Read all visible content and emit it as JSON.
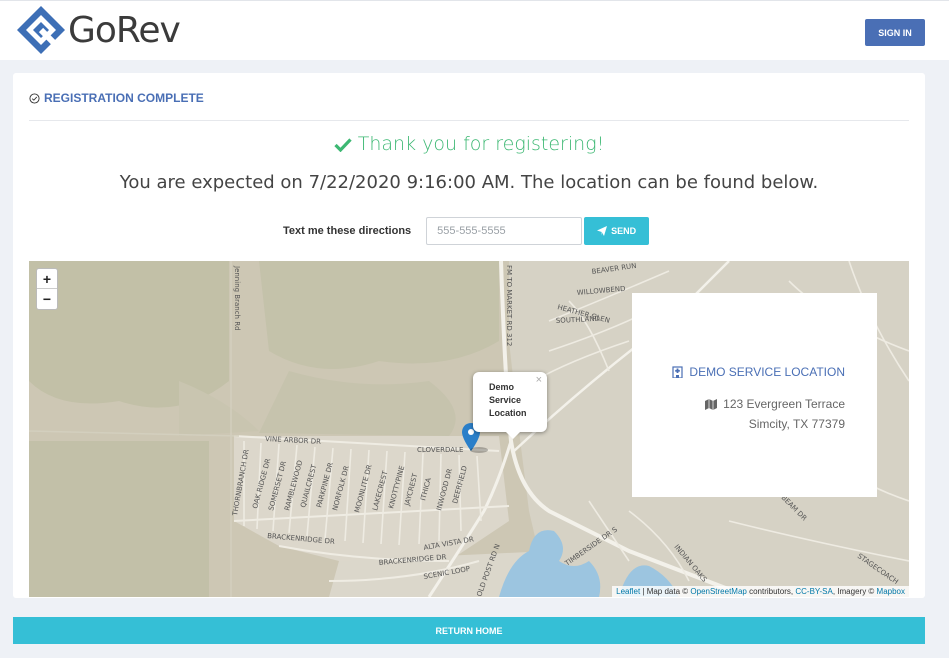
{
  "app": {
    "brand": "GoRev",
    "sign_in_label": "SIGN IN"
  },
  "page": {
    "header": "REGISTRATION COMPLETE",
    "thanks": "Thank you for registering!",
    "expected_prefix": "You are expected on ",
    "expected_datetime": "7/22/2020 9:16:00 AM",
    "expected_suffix": ". The location can be found below."
  },
  "text_directions": {
    "label": "Text me these directions",
    "placeholder": "555-555-5555",
    "value": "",
    "send_label": "SEND"
  },
  "map": {
    "zoom_in": "+",
    "zoom_out": "−",
    "popup": {
      "line1": "Demo",
      "line2": "Service",
      "line3": "Location",
      "close": "×"
    },
    "location": {
      "name": "DEMO SERVICE LOCATION",
      "address1": "123 Evergreen Terrace",
      "address2": "Simcity, TX 77379"
    },
    "attribution": {
      "leaflet": "Leaflet",
      "sep1": " | Map data © ",
      "osm": "OpenStreetMap",
      "sep2": " contributors, ",
      "license": "CC-BY-SA",
      "sep3": ", Imagery © ",
      "mapbox": "Mapbox"
    },
    "road_labels": {
      "jenning": "Jenning Branch Rd",
      "vine_arbor": "VINE ARBOR DR",
      "cloverdale": "CLOVERDALE",
      "fm_road": "FM TO MARKET RD 312",
      "beaver_run": "BEAVER RUN",
      "willowbend": "WILLOWBEND",
      "heather_glen": "HEATHER GLEN",
      "southland": "SOUTHLAND",
      "brackenridge": "BRACKENRIDGE DR",
      "brackenridge2": "BRACKENRIDGE DR",
      "alta_vista": "ALTA VISTA DR",
      "scenic_loop": "SCENIC LOOP",
      "old_post": "OLD POST RD N",
      "timberside": "TIMBERSIDE DR S",
      "indian_oaks": "INDIAN OAKS",
      "stagecoach": "STAGECOACH",
      "beam_dr": "BEAM DR",
      "thornbranch": "THORNBRANCH DR",
      "oak_ridge": "OAK RIDGE DR",
      "somerset": "SOMERSET DR",
      "ramblewood": "RAMBLEWOOD",
      "quailcrest": "QUAILCREST",
      "parkpine": "PARKPINE DR",
      "norfolk": "NORFOLK DR",
      "moonlite": "MOONLITE DR",
      "lakecrest": "LAKECREST",
      "knottypine": "KNOTTYPINE",
      "jaycrest": "JAYCREST",
      "ithica": "ITHICA",
      "inwood": "INWOOD DR",
      "deerfield": "DEERFIELD"
    }
  },
  "footer": {
    "return_label": "RETURN HOME"
  },
  "colors": {
    "brand_blue": "#4a6fb5",
    "accent_cyan": "#35bfd6",
    "success_green": "#3db873",
    "marker_blue": "#2a7fc9",
    "water": "#9cc5e0"
  }
}
